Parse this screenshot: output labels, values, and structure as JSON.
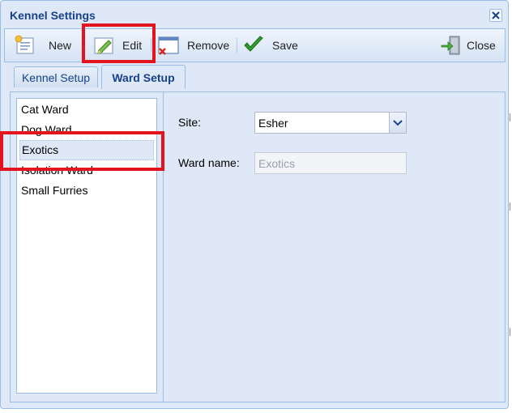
{
  "window": {
    "title": "Kennel Settings"
  },
  "toolbar": {
    "new_label": "New",
    "edit_label": "Edit",
    "remove_label": "Remove",
    "save_label": "Save",
    "close_label": "Close"
  },
  "tabs": [
    {
      "label": "Kennel Setup",
      "active": false
    },
    {
      "label": "Ward Setup",
      "active": true
    }
  ],
  "wards": [
    {
      "label": "Cat Ward"
    },
    {
      "label": "Dog Ward"
    },
    {
      "label": "Exotics",
      "selected": true
    },
    {
      "label": "Isolation Ward"
    },
    {
      "label": "Small Furries"
    }
  ],
  "form": {
    "site_label": "Site:",
    "site_value": "Esher",
    "ward_name_label": "Ward name:",
    "ward_name_value": "Exotics"
  },
  "colors": {
    "accent": "#15428b",
    "panel_bg": "#dfe8f6",
    "border": "#99bbe8",
    "highlight": "#e3141d",
    "save_check": "#2e9e2e"
  }
}
